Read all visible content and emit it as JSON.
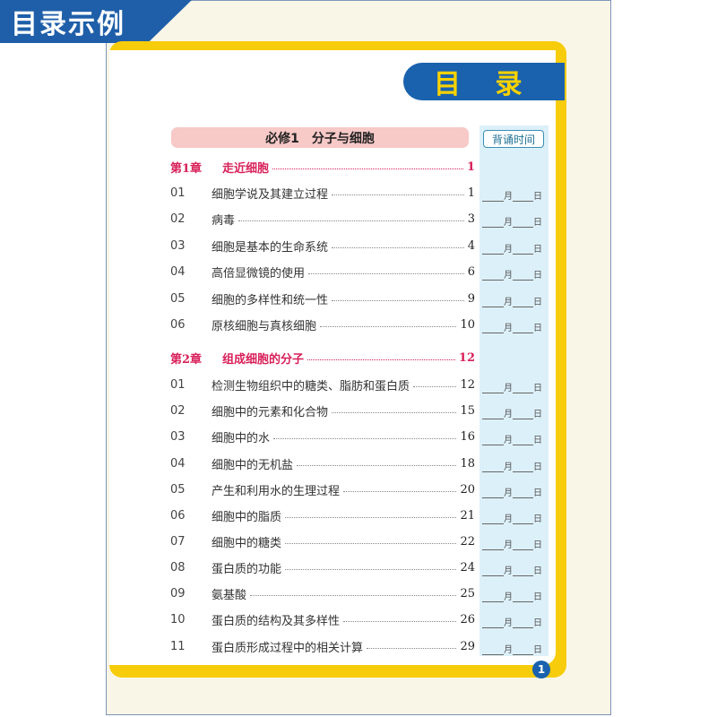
{
  "corner_label": "目录示例",
  "title": "目 录",
  "module_heading": "必修1　分子与细胞",
  "time_header": "背诵时间",
  "date_month": "月",
  "date_day": "日",
  "page_number": "1",
  "rows": [
    {
      "type": "chapter",
      "label": "第1章",
      "text": "走近细胞",
      "page": "1"
    },
    {
      "type": "item",
      "num": "01",
      "text": "细胞学说及其建立过程",
      "page": "1"
    },
    {
      "type": "item",
      "num": "02",
      "text": "病毒",
      "page": "3"
    },
    {
      "type": "item",
      "num": "03",
      "text": "细胞是基本的生命系统",
      "page": "4"
    },
    {
      "type": "item",
      "num": "04",
      "text": "高倍显微镜的使用",
      "page": "6"
    },
    {
      "type": "item",
      "num": "05",
      "text": "细胞的多样性和统一性",
      "page": "9"
    },
    {
      "type": "item",
      "num": "06",
      "text": "原核细胞与真核细胞",
      "page": "10"
    },
    {
      "type": "chapter",
      "label": "第2章",
      "text": "组成细胞的分子",
      "page": "12"
    },
    {
      "type": "item",
      "num": "01",
      "text": "检测生物组织中的糖类、脂肪和蛋白质",
      "page": "12"
    },
    {
      "type": "item",
      "num": "02",
      "text": "细胞中的元素和化合物",
      "page": "15"
    },
    {
      "type": "item",
      "num": "03",
      "text": "细胞中的水",
      "page": "16"
    },
    {
      "type": "item",
      "num": "04",
      "text": "细胞中的无机盐",
      "page": "18"
    },
    {
      "type": "item",
      "num": "05",
      "text": "产生和利用水的生理过程",
      "page": "20"
    },
    {
      "type": "item",
      "num": "06",
      "text": "细胞中的脂质",
      "page": "21"
    },
    {
      "type": "item",
      "num": "07",
      "text": "细胞中的糖类",
      "page": "22"
    },
    {
      "type": "item",
      "num": "08",
      "text": "蛋白质的功能",
      "page": "24"
    },
    {
      "type": "item",
      "num": "09",
      "text": "氨基酸",
      "page": "25"
    },
    {
      "type": "item",
      "num": "10",
      "text": "蛋白质的结构及其多样性",
      "page": "26"
    },
    {
      "type": "item",
      "num": "11",
      "text": "蛋白质形成过程中的相关计算",
      "page": "29"
    }
  ]
}
